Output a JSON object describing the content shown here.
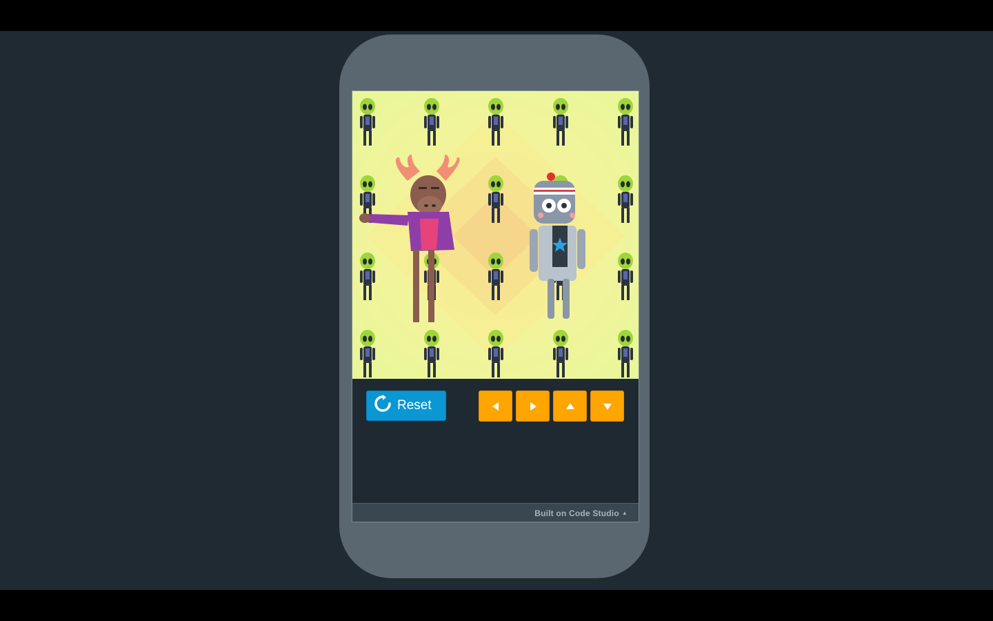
{
  "controls": {
    "reset_label": "Reset",
    "arrows": [
      "left",
      "right",
      "up",
      "down"
    ]
  },
  "footer": {
    "built_label": "Built on Code Studio",
    "caret_icon": "caret-up-icon"
  },
  "colors": {
    "reset": "#0a97d4",
    "arrow": "#ffa500",
    "stage_bg": "#202a33",
    "phone": "#5a6770"
  },
  "scene": {
    "background_sprite": "alien",
    "dancers": [
      "moose",
      "robot"
    ]
  }
}
